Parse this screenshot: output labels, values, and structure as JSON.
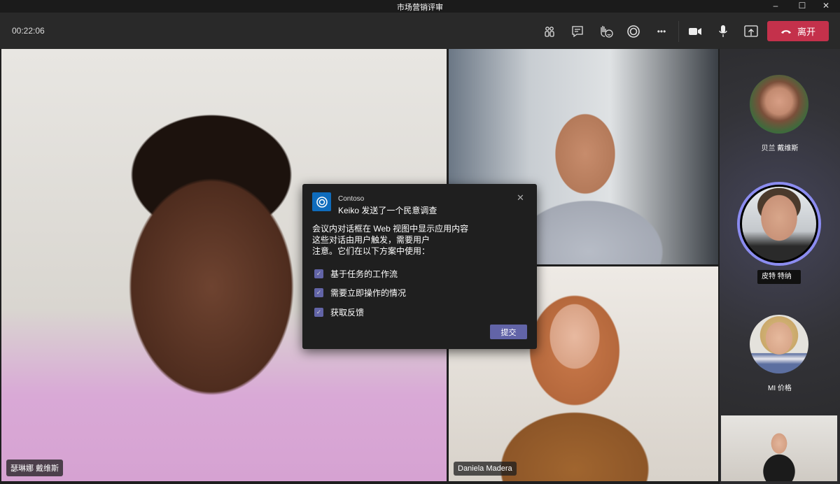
{
  "window": {
    "title": "市场营销评审",
    "minimize": "–",
    "maximize": "☐",
    "close": "✕"
  },
  "toolbar": {
    "timer": "00:22:06",
    "leave_label": "离开",
    "more": "•••"
  },
  "participants": [
    {
      "name": "瑟琳娜 戴维斯"
    },
    {
      "name": "Daniela Madera"
    }
  ],
  "rail": [
    {
      "name": "贝兰 戴维斯"
    },
    {
      "name": "皮特 特纳"
    },
    {
      "name": "MI 价格"
    }
  ],
  "dialog": {
    "app": "Contoso",
    "subtitle_name": "Keiko",
    "subtitle": "发送了一个民意调查",
    "body": [
      "会议内对话框在 Web 视图中显示应用内容",
      "这些对话由用户触发，需要用户",
      "注意。它们在以下方案中使用："
    ],
    "options": [
      {
        "label": "基于任务的工作流",
        "checked": true
      },
      {
        "label": "需要立即操作的情况",
        "checked": true
      },
      {
        "label": "获取反馈",
        "checked": true
      }
    ],
    "submit": "提交",
    "close": "✕"
  },
  "colors": {
    "accent": "#6264a7",
    "leave": "#c4314b",
    "ring": "#8b8cf0"
  }
}
